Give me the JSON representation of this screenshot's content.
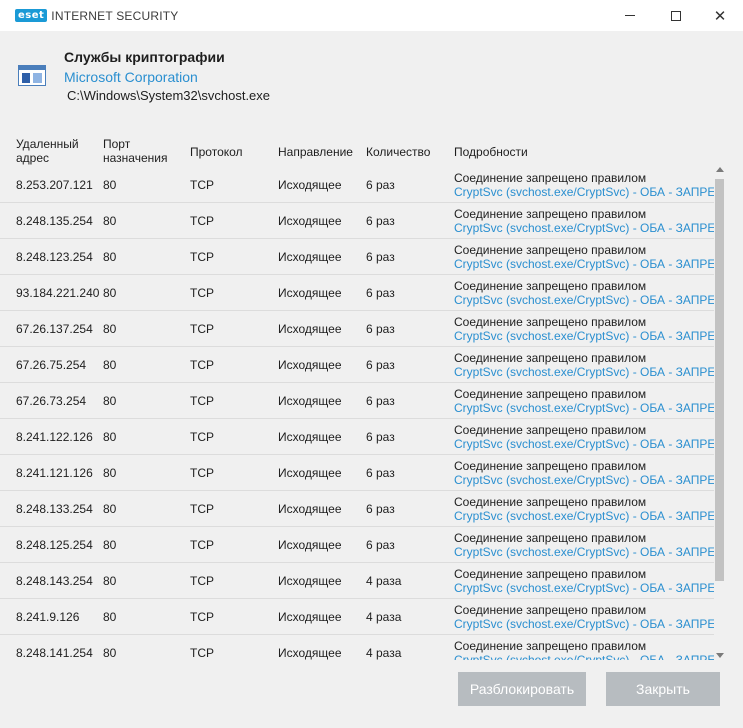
{
  "window": {
    "logo_text": "eset",
    "product_name": "INTERNET SECURITY",
    "close_glyph": "✕"
  },
  "process": {
    "title": "Службы криптографии",
    "vendor": "Microsoft Corporation",
    "path": "C:\\Windows\\System32\\svchost.exe"
  },
  "table": {
    "headers": {
      "remote_address": "Удаленный адрес",
      "dest_port": "Порт назначения",
      "protocol": "Протокол",
      "direction": "Направление",
      "count": "Количество",
      "details": "Подробности"
    },
    "rows": [
      {
        "addr": "8.253.207.121",
        "port": "80",
        "proto": "TCP",
        "dir": "Исходящее",
        "count": "6 раз",
        "detail1": "Соединение запрещено правилом",
        "detail2": "CryptSvc (svchost.exe/CryptSvc) - ОБА - ЗАПРЕТ"
      },
      {
        "addr": "8.248.135.254",
        "port": "80",
        "proto": "TCP",
        "dir": "Исходящее",
        "count": "6 раз",
        "detail1": "Соединение запрещено правилом",
        "detail2": "CryptSvc (svchost.exe/CryptSvc) - ОБА - ЗАПРЕТ"
      },
      {
        "addr": "8.248.123.254",
        "port": "80",
        "proto": "TCP",
        "dir": "Исходящее",
        "count": "6 раз",
        "detail1": "Соединение запрещено правилом",
        "detail2": "CryptSvc (svchost.exe/CryptSvc) - ОБА - ЗАПРЕТ"
      },
      {
        "addr": "93.184.221.240",
        "port": "80",
        "proto": "TCP",
        "dir": "Исходящее",
        "count": "6 раз",
        "detail1": "Соединение запрещено правилом",
        "detail2": "CryptSvc (svchost.exe/CryptSvc) - ОБА - ЗАПРЕТ"
      },
      {
        "addr": "67.26.137.254",
        "port": "80",
        "proto": "TCP",
        "dir": "Исходящее",
        "count": "6 раз",
        "detail1": "Соединение запрещено правилом",
        "detail2": "CryptSvc (svchost.exe/CryptSvc) - ОБА - ЗАПРЕТ"
      },
      {
        "addr": "67.26.75.254",
        "port": "80",
        "proto": "TCP",
        "dir": "Исходящее",
        "count": "6 раз",
        "detail1": "Соединение запрещено правилом",
        "detail2": "CryptSvc (svchost.exe/CryptSvc) - ОБА - ЗАПРЕТ"
      },
      {
        "addr": "67.26.73.254",
        "port": "80",
        "proto": "TCP",
        "dir": "Исходящее",
        "count": "6 раз",
        "detail1": "Соединение запрещено правилом",
        "detail2": "CryptSvc (svchost.exe/CryptSvc) - ОБА - ЗАПРЕТ"
      },
      {
        "addr": "8.241.122.126",
        "port": "80",
        "proto": "TCP",
        "dir": "Исходящее",
        "count": "6 раз",
        "detail1": "Соединение запрещено правилом",
        "detail2": "CryptSvc (svchost.exe/CryptSvc) - ОБА - ЗАПРЕТ"
      },
      {
        "addr": "8.241.121.126",
        "port": "80",
        "proto": "TCP",
        "dir": "Исходящее",
        "count": "6 раз",
        "detail1": "Соединение запрещено правилом",
        "detail2": "CryptSvc (svchost.exe/CryptSvc) - ОБА - ЗАПРЕТ"
      },
      {
        "addr": "8.248.133.254",
        "port": "80",
        "proto": "TCP",
        "dir": "Исходящее",
        "count": "6 раз",
        "detail1": "Соединение запрещено правилом",
        "detail2": "CryptSvc (svchost.exe/CryptSvc) - ОБА - ЗАПРЕТ"
      },
      {
        "addr": "8.248.125.254",
        "port": "80",
        "proto": "TCP",
        "dir": "Исходящее",
        "count": "6 раз",
        "detail1": "Соединение запрещено правилом",
        "detail2": "CryptSvc (svchost.exe/CryptSvc) - ОБА - ЗАПРЕТ"
      },
      {
        "addr": "8.248.143.254",
        "port": "80",
        "proto": "TCP",
        "dir": "Исходящее",
        "count": "4 раза",
        "detail1": "Соединение запрещено правилом",
        "detail2": "CryptSvc (svchost.exe/CryptSvc) - ОБА - ЗАПРЕТ"
      },
      {
        "addr": "8.241.9.126",
        "port": "80",
        "proto": "TCP",
        "dir": "Исходящее",
        "count": "4 раза",
        "detail1": "Соединение запрещено правилом",
        "detail2": "CryptSvc (svchost.exe/CryptSvc) - ОБА - ЗАПРЕТ"
      },
      {
        "addr": "8.248.141.254",
        "port": "80",
        "proto": "TCP",
        "dir": "Исходящее",
        "count": "4 раза",
        "detail1": "Соединение запрещено правилом",
        "detail2": "CryptSvc (svchost.exe/CryptSvc) - ОБА - ЗАПРЕТ"
      }
    ]
  },
  "buttons": {
    "unblock": "Разблокировать",
    "close": "Закрыть"
  },
  "colors": {
    "accent_link": "#2a8fd0",
    "button_bg": "#b7bcc0",
    "brand": "#1a9ad6"
  },
  "icons": {
    "app": "window-app-icon",
    "minimize": "minimize-icon",
    "maximize": "maximize-icon",
    "close": "close-icon"
  }
}
